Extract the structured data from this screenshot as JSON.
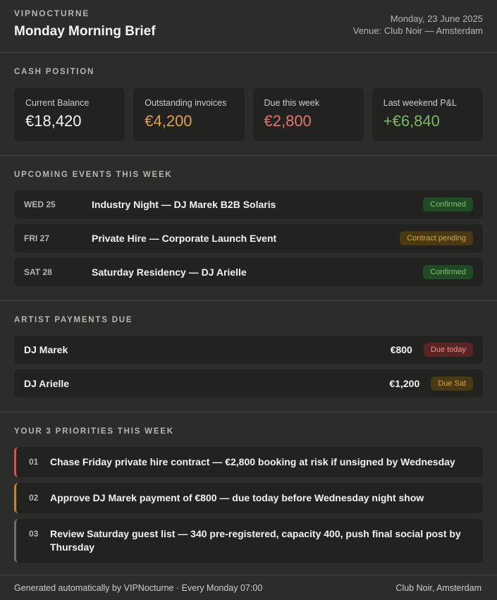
{
  "header": {
    "brand": "VIPNOCTURNE",
    "title": "Monday Morning Brief",
    "date": "Monday, 23 June 2025",
    "venue": "Venue: Club Noir — Amsterdam"
  },
  "cash": {
    "section_title": "CASH POSITION",
    "cards": [
      {
        "label": "Current Balance",
        "value": "€18,420"
      },
      {
        "label": "Outstanding invoices",
        "value": "€4,200"
      },
      {
        "label": "Due this week",
        "value": "€2,800"
      },
      {
        "label": "Last weekend P&L",
        "value": "+€6,840"
      }
    ],
    "colors": {
      "amber": "#d6a24a",
      "red": "#e0776e",
      "green": "#7bb85c"
    }
  },
  "events": {
    "section_title": "UPCOMING EVENTS THIS WEEK",
    "items": [
      {
        "date": "WED 25",
        "name": "Industry Night — DJ Marek B2B Solaris",
        "status": "Confirmed"
      },
      {
        "date": "FRI 27",
        "name": "Private Hire — Corporate Launch Event",
        "status": "Contract pending"
      },
      {
        "date": "SAT 28",
        "name": "Saturday Residency — DJ Arielle",
        "status": "Confirmed"
      }
    ]
  },
  "payments": {
    "section_title": "ARTIST PAYMENTS DUE",
    "items": [
      {
        "name": "DJ Marek",
        "amount": "€800",
        "status": "Due today"
      },
      {
        "name": "DJ Arielle",
        "amount": "€1,200",
        "status": "Due Sat"
      }
    ]
  },
  "priorities": {
    "section_title": "YOUR 3 PRIORITIES THIS WEEK",
    "items": [
      {
        "num": "01",
        "text": "Chase Friday private hire contract — €2,800 booking at risk if unsigned by Wednesday"
      },
      {
        "num": "02",
        "text": "Approve DJ Marek payment of €800 — due today before Wednesday night show"
      },
      {
        "num": "03",
        "text": "Review Saturday guest list — 340 pre-registered, capacity 400, push final social post by Thursday"
      }
    ]
  },
  "footer": {
    "left": "Generated automatically by VIPNocturne · Every Monday 07:00",
    "right": "Club Noir, Amsterdam"
  }
}
